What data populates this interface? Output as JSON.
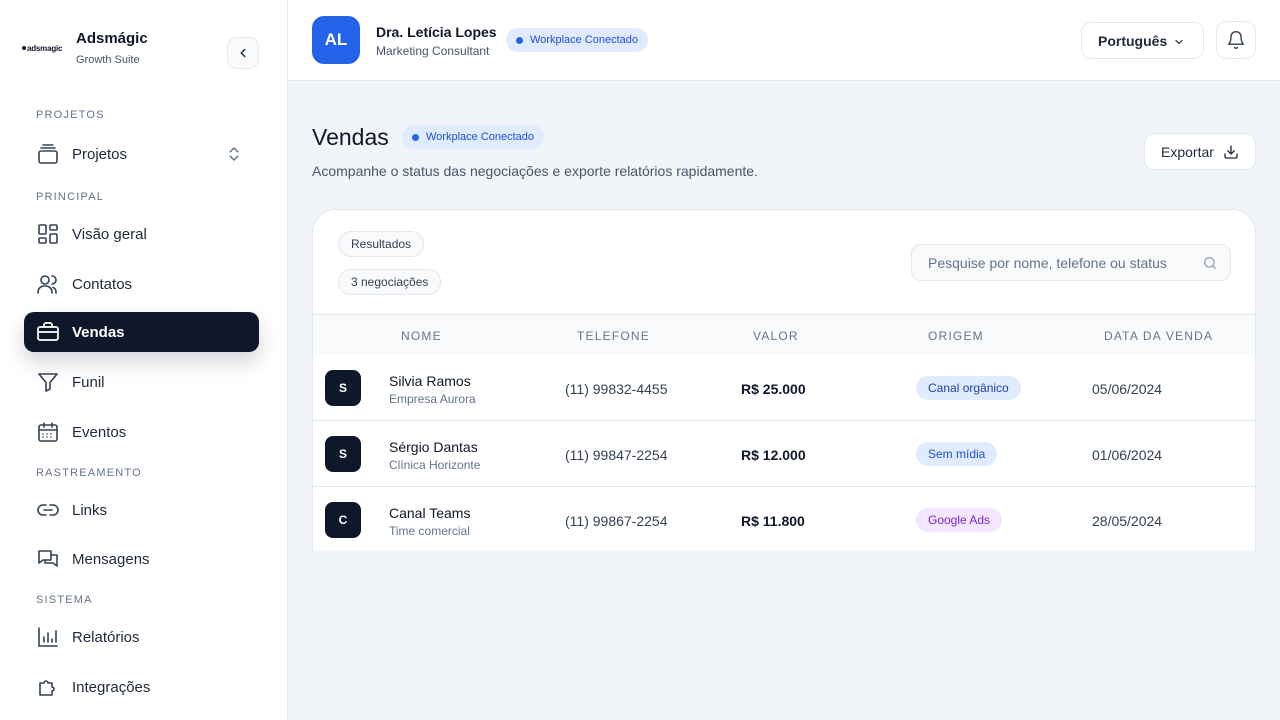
{
  "brand": {
    "logo_text": "adsmagic",
    "name": "Adsmágic",
    "subtitle": "Growth Suite"
  },
  "sidebar": {
    "sections": {
      "projetos": "PROJETOS",
      "principal": "PRINCIPAL",
      "rastreamento": "RASTREAMENTO",
      "sistema": "SISTEMA"
    },
    "items": [
      {
        "label": "Projetos",
        "icon": "layers-icon"
      },
      {
        "label": "Visão geral",
        "icon": "dashboard-icon"
      },
      {
        "label": "Contatos",
        "icon": "users-icon"
      },
      {
        "label": "Vendas",
        "icon": "briefcase-icon",
        "active": true
      },
      {
        "label": "Funil",
        "icon": "filter-icon"
      },
      {
        "label": "Eventos",
        "icon": "calendar-icon"
      },
      {
        "label": "Links",
        "icon": "link-icon"
      },
      {
        "label": "Mensagens",
        "icon": "messages-icon"
      },
      {
        "label": "Relatórios",
        "icon": "bar-chart-icon"
      },
      {
        "label": "Integrações",
        "icon": "puzzle-icon"
      }
    ]
  },
  "header": {
    "avatar_initials": "AL",
    "user_name": "Dra. Letícia Lopes",
    "user_role": "Marketing Consultant",
    "workspace_badge": "Workplace Conectado",
    "language": "Português"
  },
  "page": {
    "title": "Vendas",
    "badge": "Workplace Conectado",
    "description": "Acompanhe o status das negociações e exporte relatórios rapidamente.",
    "export_label": "Exportar"
  },
  "card": {
    "results_label": "Resultados",
    "count_label": "3 negociações",
    "search_placeholder": "Pesquise por nome, telefone ou status"
  },
  "table": {
    "columns": [
      "NOME",
      "TELEFONE",
      "VALOR",
      "ORIGEM",
      "DATA DA VENDA"
    ],
    "rows": [
      {
        "initial": "S",
        "name": "Silvia Ramos",
        "company": "Empresa Aurora",
        "phone": "(11) 99832-4455",
        "value": "R$ 25.000",
        "origin": "Canal orgânico",
        "date": "05/06/2024"
      },
      {
        "initial": "S",
        "name": "Sérgio Dantas",
        "company": "Clínica Horizonte",
        "phone": "(11) 99847-2254",
        "value": "R$ 12.000",
        "origin": "Sem mídia",
        "date": "01/06/2024"
      },
      {
        "initial": "C",
        "name": "Canal Teams",
        "company": "Time comercial",
        "phone": "(11) 99867-2254",
        "value": "R$ 11.800",
        "origin": "Google Ads",
        "date": "28/05/2024"
      }
    ]
  },
  "colors": {
    "primary": "#0f172a",
    "accent": "#2563eb",
    "badge_bg": "#e0ecfd",
    "origin_organic_bg": "#e0ecfd",
    "origin_organic_fg": "#1e40af",
    "origin_none_bg": "#e0ecfd",
    "origin_none_fg": "#1d4ed8",
    "origin_google_bg": "#f3e8ff",
    "origin_google_fg": "#7e22ce"
  }
}
